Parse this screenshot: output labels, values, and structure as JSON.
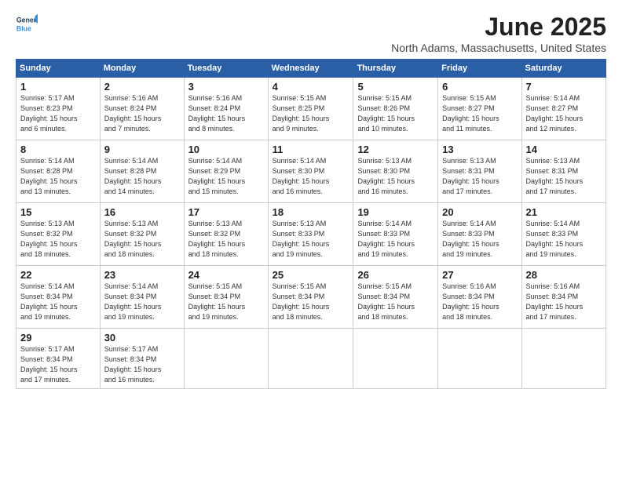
{
  "header": {
    "logo_line1": "General",
    "logo_line2": "Blue",
    "title": "June 2025",
    "location": "North Adams, Massachusetts, United States"
  },
  "columns": [
    "Sunday",
    "Monday",
    "Tuesday",
    "Wednesday",
    "Thursday",
    "Friday",
    "Saturday"
  ],
  "weeks": [
    [
      {
        "day": "1",
        "info": "Sunrise: 5:17 AM\nSunset: 8:23 PM\nDaylight: 15 hours\nand 6 minutes."
      },
      {
        "day": "2",
        "info": "Sunrise: 5:16 AM\nSunset: 8:24 PM\nDaylight: 15 hours\nand 7 minutes."
      },
      {
        "day": "3",
        "info": "Sunrise: 5:16 AM\nSunset: 8:24 PM\nDaylight: 15 hours\nand 8 minutes."
      },
      {
        "day": "4",
        "info": "Sunrise: 5:15 AM\nSunset: 8:25 PM\nDaylight: 15 hours\nand 9 minutes."
      },
      {
        "day": "5",
        "info": "Sunrise: 5:15 AM\nSunset: 8:26 PM\nDaylight: 15 hours\nand 10 minutes."
      },
      {
        "day": "6",
        "info": "Sunrise: 5:15 AM\nSunset: 8:27 PM\nDaylight: 15 hours\nand 11 minutes."
      },
      {
        "day": "7",
        "info": "Sunrise: 5:14 AM\nSunset: 8:27 PM\nDaylight: 15 hours\nand 12 minutes."
      }
    ],
    [
      {
        "day": "8",
        "info": "Sunrise: 5:14 AM\nSunset: 8:28 PM\nDaylight: 15 hours\nand 13 minutes."
      },
      {
        "day": "9",
        "info": "Sunrise: 5:14 AM\nSunset: 8:28 PM\nDaylight: 15 hours\nand 14 minutes."
      },
      {
        "day": "10",
        "info": "Sunrise: 5:14 AM\nSunset: 8:29 PM\nDaylight: 15 hours\nand 15 minutes."
      },
      {
        "day": "11",
        "info": "Sunrise: 5:14 AM\nSunset: 8:30 PM\nDaylight: 15 hours\nand 16 minutes."
      },
      {
        "day": "12",
        "info": "Sunrise: 5:13 AM\nSunset: 8:30 PM\nDaylight: 15 hours\nand 16 minutes."
      },
      {
        "day": "13",
        "info": "Sunrise: 5:13 AM\nSunset: 8:31 PM\nDaylight: 15 hours\nand 17 minutes."
      },
      {
        "day": "14",
        "info": "Sunrise: 5:13 AM\nSunset: 8:31 PM\nDaylight: 15 hours\nand 17 minutes."
      }
    ],
    [
      {
        "day": "15",
        "info": "Sunrise: 5:13 AM\nSunset: 8:32 PM\nDaylight: 15 hours\nand 18 minutes."
      },
      {
        "day": "16",
        "info": "Sunrise: 5:13 AM\nSunset: 8:32 PM\nDaylight: 15 hours\nand 18 minutes."
      },
      {
        "day": "17",
        "info": "Sunrise: 5:13 AM\nSunset: 8:32 PM\nDaylight: 15 hours\nand 18 minutes."
      },
      {
        "day": "18",
        "info": "Sunrise: 5:13 AM\nSunset: 8:33 PM\nDaylight: 15 hours\nand 19 minutes."
      },
      {
        "day": "19",
        "info": "Sunrise: 5:14 AM\nSunset: 8:33 PM\nDaylight: 15 hours\nand 19 minutes."
      },
      {
        "day": "20",
        "info": "Sunrise: 5:14 AM\nSunset: 8:33 PM\nDaylight: 15 hours\nand 19 minutes."
      },
      {
        "day": "21",
        "info": "Sunrise: 5:14 AM\nSunset: 8:33 PM\nDaylight: 15 hours\nand 19 minutes."
      }
    ],
    [
      {
        "day": "22",
        "info": "Sunrise: 5:14 AM\nSunset: 8:34 PM\nDaylight: 15 hours\nand 19 minutes."
      },
      {
        "day": "23",
        "info": "Sunrise: 5:14 AM\nSunset: 8:34 PM\nDaylight: 15 hours\nand 19 minutes."
      },
      {
        "day": "24",
        "info": "Sunrise: 5:15 AM\nSunset: 8:34 PM\nDaylight: 15 hours\nand 19 minutes."
      },
      {
        "day": "25",
        "info": "Sunrise: 5:15 AM\nSunset: 8:34 PM\nDaylight: 15 hours\nand 18 minutes."
      },
      {
        "day": "26",
        "info": "Sunrise: 5:15 AM\nSunset: 8:34 PM\nDaylight: 15 hours\nand 18 minutes."
      },
      {
        "day": "27",
        "info": "Sunrise: 5:16 AM\nSunset: 8:34 PM\nDaylight: 15 hours\nand 18 minutes."
      },
      {
        "day": "28",
        "info": "Sunrise: 5:16 AM\nSunset: 8:34 PM\nDaylight: 15 hours\nand 17 minutes."
      }
    ],
    [
      {
        "day": "29",
        "info": "Sunrise: 5:17 AM\nSunset: 8:34 PM\nDaylight: 15 hours\nand 17 minutes."
      },
      {
        "day": "30",
        "info": "Sunrise: 5:17 AM\nSunset: 8:34 PM\nDaylight: 15 hours\nand 16 minutes."
      },
      {
        "day": "",
        "info": ""
      },
      {
        "day": "",
        "info": ""
      },
      {
        "day": "",
        "info": ""
      },
      {
        "day": "",
        "info": ""
      },
      {
        "day": "",
        "info": ""
      }
    ]
  ]
}
